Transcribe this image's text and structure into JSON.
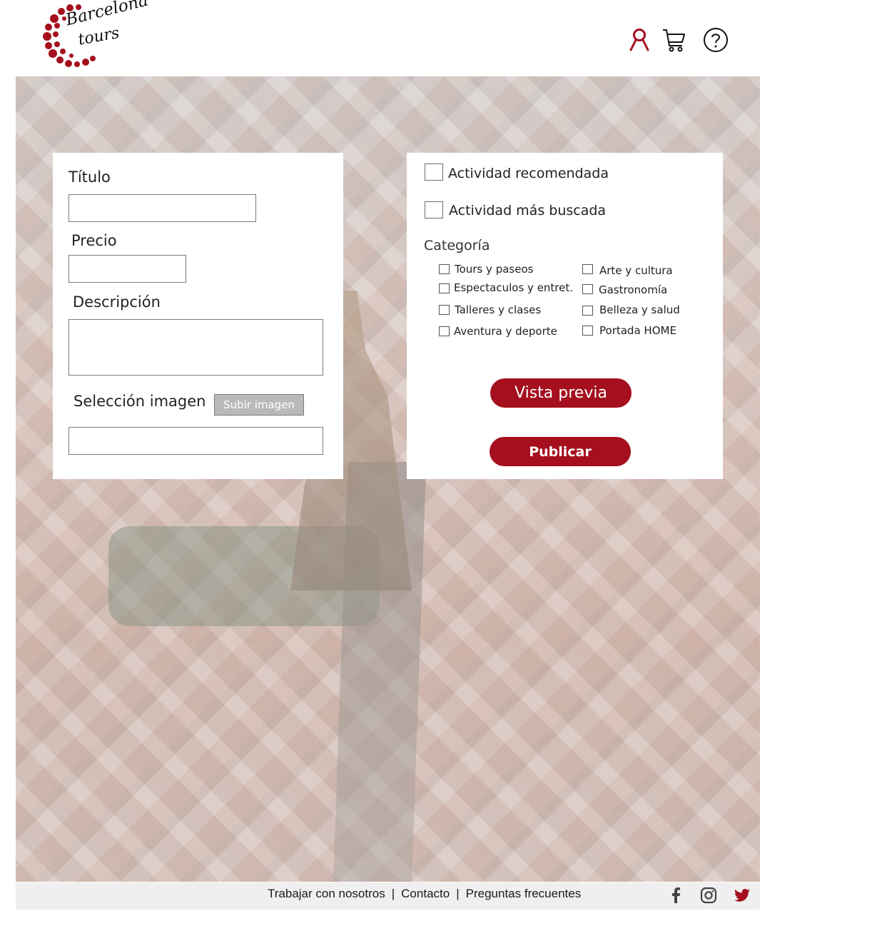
{
  "brand": {
    "logo_line1": "Barcelona",
    "logo_line2": "tours",
    "accent_color": "#a50f1e"
  },
  "header": {
    "icons": [
      "user-icon",
      "cart-icon",
      "help-icon"
    ]
  },
  "form_left": {
    "title_label": "Título",
    "title_value": "",
    "price_label": "Precio",
    "price_value": "",
    "description_label": "Descripción",
    "description_value": "",
    "image_label": "Selección imagen",
    "upload_button": "Subir imagen",
    "image_value": ""
  },
  "form_right": {
    "recommended_label": "Actividad recomendada",
    "recommended_checked": false,
    "most_searched_label": "Actividad más buscada",
    "most_searched_checked": false,
    "category_title": "Categoría",
    "categories": [
      {
        "label": "Tours y paseos",
        "checked": false
      },
      {
        "label": "Espectaculos y entret.",
        "checked": false
      },
      {
        "label": "Talleres y clases",
        "checked": false
      },
      {
        "label": "Aventura y deporte",
        "checked": false
      },
      {
        "label": "Arte y cultura",
        "checked": false
      },
      {
        "label": "Gastronomía",
        "checked": false
      },
      {
        "label": "Belleza y salud",
        "checked": false
      },
      {
        "label": "Portada HOME",
        "checked": false
      }
    ],
    "preview_button": "Vista previa",
    "publish_button": "Publicar"
  },
  "footer": {
    "links": [
      "Trabajar con nosotros",
      "Contacto",
      "Preguntas frecuentes"
    ],
    "separator": "|",
    "social": [
      "facebook-icon",
      "instagram-icon",
      "twitter-icon"
    ]
  }
}
